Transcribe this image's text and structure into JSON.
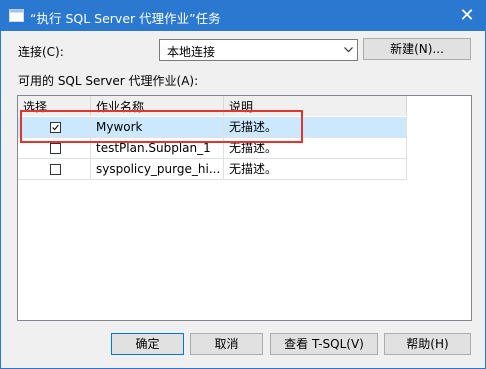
{
  "window": {
    "title": "“执行 SQL Server 代理作业”任务",
    "close_label": "✕"
  },
  "connection": {
    "label": "连接(C):",
    "value": "本地连接",
    "new_button": "新建(N)..."
  },
  "jobs": {
    "label": "可用的 SQL Server 代理作业(A):",
    "columns": [
      "选择",
      "作业名称",
      "说明"
    ],
    "rows": [
      {
        "checked": true,
        "name": "Mywork",
        "description": "无描述。"
      },
      {
        "checked": false,
        "name": "testPlan.Subplan_1",
        "description": "无描述。"
      },
      {
        "checked": false,
        "name": "syspolicy_purge_hi...",
        "description": "无描述。"
      }
    ]
  },
  "footer": {
    "ok": "确定",
    "cancel": "取消",
    "view_tsql": "查看 T-SQL(V)",
    "help": "帮助(H)"
  },
  "colors": {
    "title_bar": "#2b78d0",
    "selection": "#cce8ff",
    "highlight": "#e0362f"
  }
}
